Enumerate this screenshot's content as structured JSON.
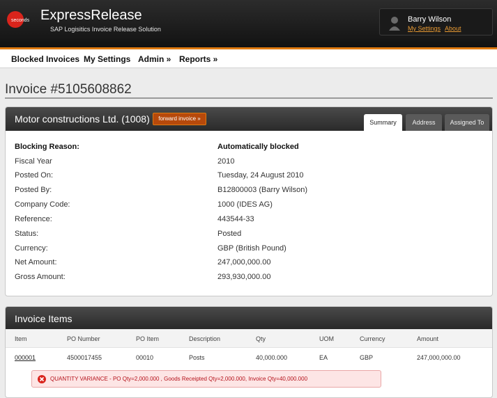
{
  "header": {
    "app_title": "ExpressRelease",
    "subtitle": "SAP Logisitics Invoice Release Solution",
    "logo_text": "seconds",
    "user_name": "Barry Wilson",
    "my_settings_link": "My Settings",
    "about_link": "About"
  },
  "nav": {
    "items": [
      "Blocked Invoices",
      "My Settings",
      "Admin »",
      "Reports »"
    ]
  },
  "page": {
    "title": "Invoice #5105608862"
  },
  "summary_panel": {
    "vendor": "Motor constructions Ltd. (1008)",
    "forward_button": "forward invoice »",
    "tabs": [
      "Summary",
      "Address",
      "Assigned To"
    ],
    "active_tab": "Summary",
    "fields": [
      {
        "label": "Blocking Reason:",
        "value": "Automatically blocked"
      },
      {
        "label": "Fiscal Year",
        "value": "2010"
      },
      {
        "label": "Posted On:",
        "value": "Tuesday, 24 August 2010"
      },
      {
        "label": "Posted By:",
        "value": "B12800003  (Barry Wilson)"
      },
      {
        "label": "Company Code:",
        "value": "1000  (IDES AG)"
      },
      {
        "label": "Reference:",
        "value": "443544-33"
      },
      {
        "label": "Status:",
        "value": "Posted"
      },
      {
        "label": "Currency:",
        "value": "GBP  (British Pound)"
      },
      {
        "label": "Net Amount:",
        "value": "247,000,000.00"
      },
      {
        "label": "Gross Amount:",
        "value": "293,930,000.00"
      }
    ]
  },
  "items_panel": {
    "title": "Invoice Items",
    "columns": [
      "Item",
      "PO Number",
      "PO Item",
      "Description",
      "Qty",
      "UOM",
      "Currency",
      "Amount"
    ],
    "rows": [
      {
        "item": "000001",
        "po_number": "4500017455",
        "po_item": "00010",
        "description": "Posts",
        "qty": "40,000.000",
        "uom": "EA",
        "currency": "GBP",
        "amount": "247,000,000.00"
      }
    ],
    "error_message": "QUANTITY VARIANCE - PO Qty=2,000.000 , Goods Receipted Qty=2,000.000, Invoice Qty=40,000.000"
  },
  "colors": {
    "accent": "#e07a10",
    "button": "#b7490b",
    "error_text": "#b5121b"
  }
}
